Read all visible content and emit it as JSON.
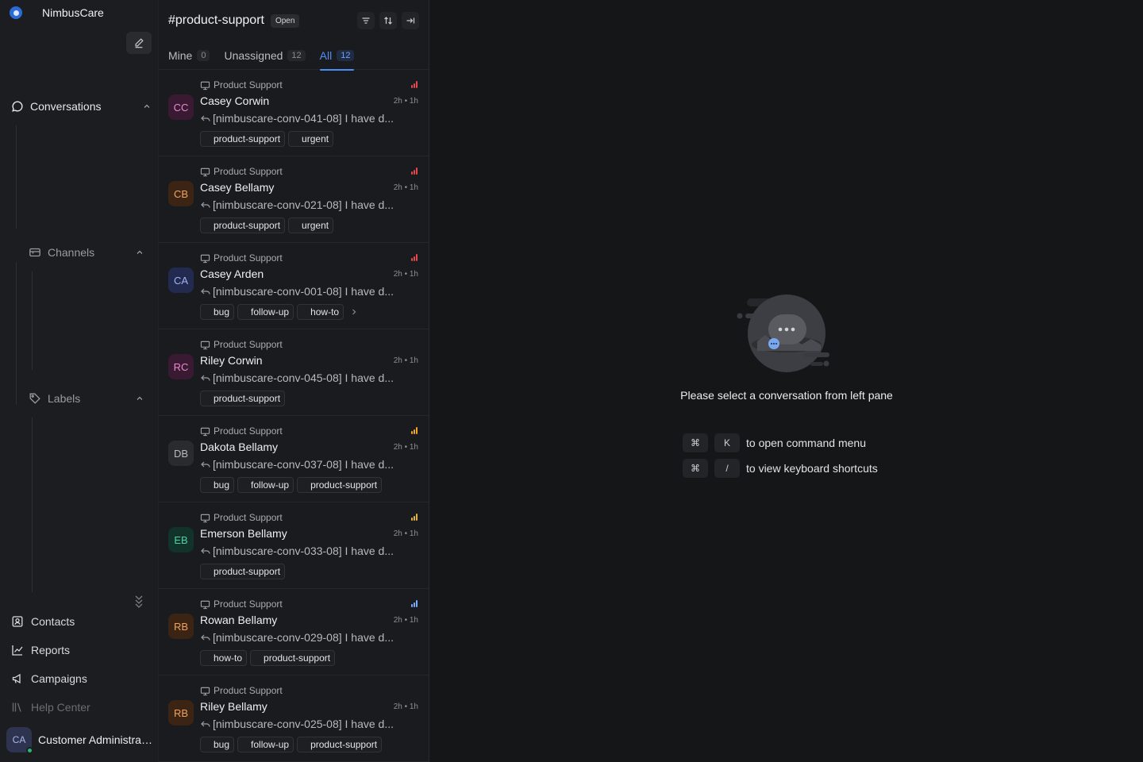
{
  "brand": {
    "name": "NimbusCare"
  },
  "sidebar": {
    "conversations_label": "Conversations",
    "channels_label": "Channels",
    "labels_label": "Labels",
    "nav": [
      {
        "label": "Contacts",
        "icon": "contacts-icon"
      },
      {
        "label": "Reports",
        "icon": "reports-icon"
      },
      {
        "label": "Campaigns",
        "icon": "campaigns-icon"
      },
      {
        "label": "Help Center",
        "icon": "help-center-icon"
      }
    ],
    "user": {
      "initials": "CA",
      "name": "Customer Administrator",
      "status_color": "#2bb673"
    }
  },
  "list": {
    "title": "#product-support",
    "status": "Open",
    "tabs": [
      {
        "label": "Mine",
        "count": "0"
      },
      {
        "label": "Unassigned",
        "count": "12"
      },
      {
        "label": "All",
        "count": "12",
        "active": true
      }
    ],
    "conversations": [
      {
        "initials": "CC",
        "name": "Casey Corwin",
        "inbox": "Product Support",
        "time": "2h • 1h",
        "message": "[nimbuscare-conv-041-08] I have d...",
        "priority": "urgent",
        "avatar_bg": "#3a1a33",
        "avatar_fg": "#e88bd0",
        "labels": [
          "product-support",
          "urgent"
        ],
        "more": false
      },
      {
        "initials": "CB",
        "name": "Casey Bellamy",
        "inbox": "Product Support",
        "time": "2h • 1h",
        "message": "[nimbuscare-conv-021-08] I have d...",
        "priority": "urgent",
        "avatar_bg": "#3b2414",
        "avatar_fg": "#f0a35e",
        "labels": [
          "product-support",
          "urgent"
        ],
        "more": false
      },
      {
        "initials": "CA",
        "name": "Casey Arden",
        "inbox": "Product Support",
        "time": "2h • 1h",
        "message": "[nimbuscare-conv-001-08] I have d...",
        "priority": "urgent",
        "avatar_bg": "#222b4f",
        "avatar_fg": "#9fb4f3",
        "labels": [
          "bug",
          "follow-up",
          "how-to"
        ],
        "more": true
      },
      {
        "initials": "RC",
        "name": "Riley Corwin",
        "inbox": "Product Support",
        "time": "2h • 1h",
        "message": "[nimbuscare-conv-045-08] I have d...",
        "priority": "none",
        "avatar_bg": "#3a1a33",
        "avatar_fg": "#e88bd0",
        "labels": [
          "product-support"
        ],
        "more": false
      },
      {
        "initials": "DB",
        "name": "Dakota Bellamy",
        "inbox": "Product Support",
        "time": "2h • 1h",
        "message": "[nimbuscare-conv-037-08] I have d...",
        "priority": "high",
        "avatar_bg": "#2a2b2f",
        "avatar_fg": "#b9bac0",
        "labels": [
          "bug",
          "follow-up",
          "product-support"
        ],
        "more": false
      },
      {
        "initials": "EB",
        "name": "Emerson Bellamy",
        "inbox": "Product Support",
        "time": "2h • 1h",
        "message": "[nimbuscare-conv-033-08] I have d...",
        "priority": "medium",
        "avatar_bg": "#113329",
        "avatar_fg": "#4fd1a5",
        "labels": [
          "product-support"
        ],
        "more": false
      },
      {
        "initials": "RB",
        "name": "Rowan Bellamy",
        "inbox": "Product Support",
        "time": "2h • 1h",
        "message": "[nimbuscare-conv-029-08] I have d...",
        "priority": "low",
        "avatar_bg": "#3b2414",
        "avatar_fg": "#f0a35e",
        "labels": [
          "how-to",
          "product-support"
        ],
        "more": false
      },
      {
        "initials": "RB",
        "name": "Riley Bellamy",
        "inbox": "Product Support",
        "time": "2h • 1h",
        "message": "[nimbuscare-conv-025-08] I have d...",
        "priority": "none",
        "avatar_bg": "#3b2414",
        "avatar_fg": "#f0a35e",
        "labels": [
          "bug",
          "follow-up",
          "product-support"
        ],
        "more": false
      }
    ]
  },
  "empty": {
    "message": "Please select a conversation from left pane",
    "shortcuts": [
      {
        "keys": [
          "⌘",
          "K"
        ],
        "description": "to open command menu"
      },
      {
        "keys": [
          "⌘",
          "/"
        ],
        "description": "to view keyboard shortcuts"
      }
    ]
  },
  "colors": {
    "accent": "#4f8ef7",
    "urgent": "#e5484d",
    "high": "#f5a524",
    "medium": "#e0b341",
    "low": "#7aa7ff"
  }
}
